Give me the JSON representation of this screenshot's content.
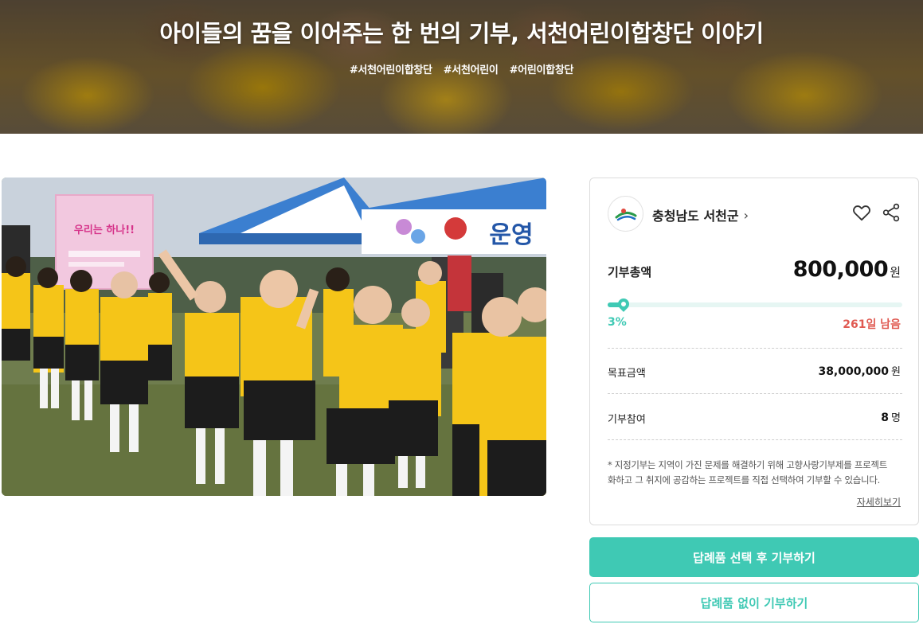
{
  "hero": {
    "title": "아이들의 꿈을 이어주는 한 번의 기부, 서천어린이합창단 이야기",
    "tags": [
      "#서천어린이합창단",
      "#서천어린이",
      "#어린이합창단"
    ]
  },
  "photo": {
    "banner_text": "운영",
    "sign_text": "우리는 하나!!"
  },
  "card": {
    "org_name": "충청남도 서천군",
    "total_label": "기부총액",
    "total_amount": "800,000",
    "total_unit": "원",
    "progress_percent": 3,
    "percent_text": "3%",
    "days_left": "261일 남음",
    "goal_label": "목표금액",
    "goal_amount": "38,000,000",
    "goal_unit": "원",
    "participants_label": "기부참여",
    "participants_count": "8",
    "participants_unit": "명",
    "note_line1": "* 지정기부는 지역이 가진 문제를 해결하기 위해 고향사랑기부제를 프로젝트",
    "note_line2": "화하고 그 취지에 공감하는 프로젝트를 직접 선택하여 기부할 수 있습니다.",
    "more_link": "자세히보기"
  },
  "buttons": {
    "primary": "답례품 선택 후 기부하기",
    "secondary": "답례품 없이 기부하기"
  },
  "colors": {
    "accent": "#3fc9b4",
    "days_left": "#e05a52",
    "uniform_yellow": "#f5c518"
  },
  "icons": {
    "org_logo": "seocheon-logo-icon",
    "heart": "heart-icon",
    "share": "share-icon",
    "chevron": "chevron-right-icon"
  }
}
